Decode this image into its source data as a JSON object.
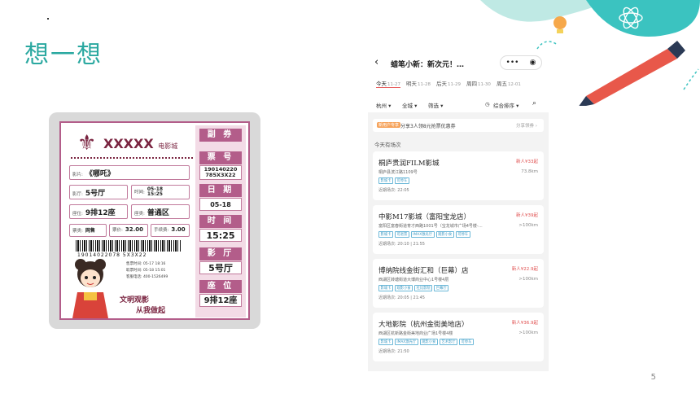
{
  "slide": {
    "title": "想一想",
    "page": "5"
  },
  "ticket": {
    "cinema": "XXXXX",
    "cinema_suffix": "电影城",
    "film_label": "影片:",
    "film": "《哪吒》",
    "hall_label": "影厅:",
    "hall": "5号厅",
    "time_label": "时间:",
    "time": "05-18\n15:25",
    "seat_label": "座位:",
    "seat": "9排12座",
    "area_label": "座类:",
    "area": "普通区",
    "type_label": "票类:",
    "type": "网售",
    "price_label": "票价:",
    "price": "32.00",
    "fee_label": "手续费:",
    "fee": "3.00",
    "barcode": "19014022078 5X3X22",
    "sell_time": "售票时间: 05-17 18:16",
    "pickup_time": "取票时间: 05-18 15:01",
    "hotline": "客服电话: 400-1526499",
    "slogan1": "文明观影",
    "slogan2": "从我做起",
    "side": [
      {
        "label": "副 券",
        "value": ""
      },
      {
        "label": "票 号",
        "value": "190140220\n785X3X22"
      },
      {
        "label": "日 期",
        "value": "05-18"
      },
      {
        "label": "时 间",
        "value": "15:25"
      },
      {
        "label": "影 厅",
        "value": "5号厅"
      },
      {
        "label": "座 位",
        "value": "9排12座"
      }
    ]
  },
  "phone": {
    "title": "蜡笔小新：新次元！…",
    "capsule_more": "•••",
    "days": [
      {
        "label": "今天",
        "date": "11-27",
        "active": true
      },
      {
        "label": "明天",
        "date": "11-28"
      },
      {
        "label": "后天",
        "date": "11-29"
      },
      {
        "label": "周四",
        "date": "11-30"
      },
      {
        "label": "周五",
        "date": "12-01"
      }
    ],
    "filter_city": "杭州 ▾",
    "filter_area": "全城 ▾",
    "filter_select": "筛选 ▾",
    "filter_sort": "综合排序 ▾",
    "promo_badge": "新用户专享",
    "promo_text": "分享3人领8元抢票优惠券",
    "promo_more": "分享领券 ›",
    "section": "今天有场次",
    "cinemas": [
      {
        "name": "桐庐贵润FILM影城",
        "price": "新人¥33起",
        "addr": "桐庐县滨江路1109号",
        "dist": "73.8km",
        "tags": [
          "影城卡",
          "可停车"
        ],
        "time": "近期场次: 22:05"
      },
      {
        "name": "中影M17影城（富阳宝龙店）",
        "price": "新人¥39起",
        "addr": "富阳区富春街道育才西路1001号（宝龙城市广场4号楼-…",
        "dist": ">100km",
        "tags": [
          "影城卡",
          "可退票",
          "IMAX激光厅",
          "观影小食",
          "可停车"
        ],
        "time": "近期场次: 20:10 | 21:55"
      },
      {
        "name": "博纳院线金街汇和（巨幕）店",
        "price": "新人¥22.9起",
        "addr": "西湖区转塘街道大博商业中心1号楼4层",
        "dist": ">100km",
        "tags": [
          "影城卡",
          "观影小食",
          "杜比影院",
          "巨幕厅"
        ],
        "time": "近期场次: 20:05 | 21:45"
      },
      {
        "name": "大地影院（杭州金街美地店）",
        "price": "新人¥36.9起",
        "addr": "西湖区杭新路金街美地商业广场1号楼4楼",
        "dist": ">100km",
        "tags": [
          "影城卡",
          "IMAX激光厅",
          "观影小食",
          "艺术影厅",
          "可停车"
        ],
        "time": "近期场次: 21:50"
      }
    ]
  }
}
